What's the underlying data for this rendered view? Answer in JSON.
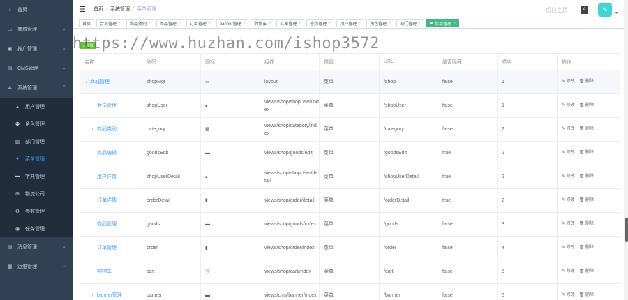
{
  "sidebar": {
    "items": [
      {
        "label": "首页",
        "icon": "dashboard-icon",
        "glyph": "◕"
      },
      {
        "label": "商城管理",
        "icon": "shop-icon",
        "glyph": "▭",
        "arrow": "⌄"
      },
      {
        "label": "推广管理",
        "icon": "promotion-icon",
        "glyph": "▣",
        "arrow": "⌄"
      },
      {
        "label": "CMS管理",
        "icon": "cms-icon",
        "glyph": "▤",
        "arrow": "⌄"
      },
      {
        "label": "系统管理",
        "icon": "gear-icon",
        "glyph": "✲",
        "arrow": "⌃"
      }
    ],
    "submenu": [
      {
        "label": "用户管理",
        "icon": "user-icon",
        "glyph": "▴"
      },
      {
        "label": "角色管理",
        "icon": "role-icon",
        "glyph": "⚉"
      },
      {
        "label": "部门管理",
        "icon": "department-icon",
        "glyph": "▥"
      },
      {
        "label": "菜单管理",
        "icon": "menu-icon",
        "glyph": "●"
      },
      {
        "label": "字典管理",
        "icon": "dictionary-icon",
        "glyph": "▬"
      },
      {
        "label": "物流公司",
        "icon": "logistics-icon",
        "glyph": "⊞"
      },
      {
        "label": "参数管理",
        "icon": "params-icon",
        "glyph": "⚙"
      },
      {
        "label": "任务管理",
        "icon": "task-icon",
        "glyph": "◉"
      }
    ],
    "bottom": [
      {
        "label": "消息管理",
        "icon": "message-icon",
        "glyph": "▤",
        "arrow": "⌄"
      },
      {
        "label": "运维管理",
        "icon": "ops-icon",
        "glyph": "▦",
        "arrow": "⌄"
      }
    ]
  },
  "navbar": {
    "hamburger": "☰",
    "breadcrumb": [
      "首页",
      "系统管理",
      "菜单管理"
    ],
    "separator": "/",
    "home_link": "后台主页",
    "font_icon": "A",
    "avatar_glyph": "✎",
    "caret": "▼"
  },
  "tags": [
    {
      "label": "首页"
    },
    {
      "label": "会员管理"
    },
    {
      "label": "商品类别"
    },
    {
      "label": "商品管理"
    },
    {
      "label": "订单管理"
    },
    {
      "label": "banner管理"
    },
    {
      "label": "购物车"
    },
    {
      "label": "文章管理"
    },
    {
      "label": "签约管理"
    },
    {
      "label": "用户管理"
    },
    {
      "label": "角色管理"
    },
    {
      "label": "部门管理"
    },
    {
      "label": "菜单管理",
      "active": true
    }
  ],
  "tag_close": "×",
  "add_button": "+ 添加",
  "watermark": "https://www.huzhan.com/ishop3572",
  "table": {
    "headers": [
      "名称",
      "编码",
      "图标",
      "组件",
      "类型",
      "URL",
      "是否隐藏",
      "顺序",
      "操作"
    ],
    "edit_label": "✎ 修改",
    "delete_label": "🗑 删除",
    "rows": [
      {
        "name": "商城管理",
        "level": 0,
        "expand": "⌄",
        "code": "shopMgr",
        "icon": "▭",
        "component": "layout",
        "type": "菜单",
        "url": "/shop",
        "hidden": "false",
        "order": "1"
      },
      {
        "name": "会员管理",
        "level": 1,
        "expand": "",
        "code": "shopUser",
        "icon": "▴",
        "component": "views/shop/shopUser/index",
        "type": "菜单",
        "url": "/shopUser",
        "hidden": "false",
        "order": "1"
      },
      {
        "name": "商品类别",
        "level": 1,
        "expand": "›",
        "code": "category",
        "icon": "▦",
        "component": "views/shop/category/index",
        "type": "菜单",
        "url": "/category",
        "hidden": "false",
        "order": "2"
      },
      {
        "name": "商品编辑",
        "level": 1,
        "expand": "",
        "code": "goodsEdit",
        "icon": "▬",
        "component": "views/shop/goods/edit",
        "type": "菜单",
        "url": "/goodsEdit",
        "hidden": "true",
        "order": "2"
      },
      {
        "name": "用户详情",
        "level": 1,
        "expand": "",
        "code": "shopUserDetail",
        "icon": "▴",
        "component": "views/shop/shopUser/detail",
        "type": "菜单",
        "url": "/shopUserDetail",
        "hidden": "true",
        "order": "2"
      },
      {
        "name": "订单详情",
        "level": 1,
        "expand": "",
        "code": "orderDetail",
        "icon": "▮",
        "component": "views/shop/order/detail",
        "type": "菜单",
        "url": "/orderDetail",
        "hidden": "true",
        "order": "2"
      },
      {
        "name": "商品管理",
        "level": 1,
        "expand": "",
        "code": "goods",
        "icon": "▬",
        "component": "views/shop/goods/index",
        "type": "菜单",
        "url": "/goods",
        "hidden": "false",
        "order": "3"
      },
      {
        "name": "订单管理",
        "level": 1,
        "expand": "",
        "code": "order",
        "icon": "▮",
        "component": "views/shop/order/index",
        "type": "菜单",
        "url": "/order",
        "hidden": "false",
        "order": "4"
      },
      {
        "name": "购物车",
        "level": 1,
        "expand": "",
        "code": "cart",
        "icon": "🛒",
        "component": "views/shop/cart/index",
        "type": "菜单",
        "url": "/cart",
        "hidden": "false",
        "order": "5"
      },
      {
        "name": "banner管理",
        "level": 1,
        "expand": "›",
        "code": "banner",
        "icon": "▬",
        "component": "views/cms/banner/index",
        "type": "菜单",
        "url": "/banner",
        "hidden": "false",
        "order": "6"
      }
    ]
  }
}
